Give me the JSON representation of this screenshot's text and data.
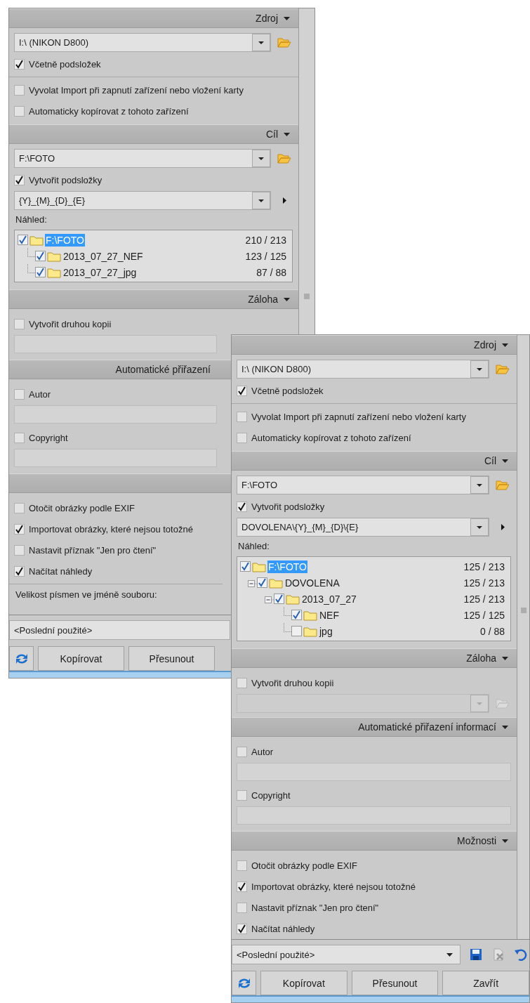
{
  "windows": [
    {
      "sections": [
        {
          "title": "Zdroj",
          "items": [
            {
              "kind": "path",
              "value": "I:\\ (NIKON D800)"
            },
            {
              "kind": "check",
              "label": "Včetně podsložek",
              "checked": true
            },
            {
              "kind": "rule"
            },
            {
              "kind": "check",
              "label": "Vyvolat Import při zapnutí zařízení nebo vložení karty",
              "checked": false
            },
            {
              "kind": "check",
              "label": "Automaticky kopírovat z tohoto zařízení",
              "checked": false
            }
          ]
        },
        {
          "title": "Cíl",
          "items": [
            {
              "kind": "path",
              "value": "F:\\FOTO"
            },
            {
              "kind": "check",
              "label": "Vytvořit podsložky",
              "checked": true
            },
            {
              "kind": "pattern",
              "value": "{Y}_{M}_{D}_{E}"
            },
            {
              "kind": "label",
              "text": "Náhled:"
            },
            {
              "kind": "tree",
              "nodes": [
                {
                  "label": "F:\\FOTO",
                  "count": "210 / 213",
                  "checked": true,
                  "selected": true,
                  "children": [
                    {
                      "label": "2013_07_27_NEF",
                      "count": "123 / 125",
                      "checked": true,
                      "selected": false
                    },
                    {
                      "label": "2013_07_27_jpg",
                      "count": "87 / 88",
                      "checked": true,
                      "selected": false
                    }
                  ]
                }
              ]
            }
          ]
        },
        {
          "title": "Záloha",
          "items": [
            {
              "kind": "check",
              "label": "Vytvořit druhou kopii",
              "checked": false
            },
            {
              "kind": "field"
            }
          ]
        },
        {
          "title": "Automatické přiřazení",
          "items": [
            {
              "kind": "check",
              "label": "Autor",
              "checked": false
            },
            {
              "kind": "field"
            },
            {
              "kind": "check",
              "label": "Copyright",
              "checked": false
            },
            {
              "kind": "field"
            }
          ]
        },
        {
          "items": [
            {
              "kind": "check",
              "label": "Otočit obrázky podle EXIF",
              "checked": false
            },
            {
              "kind": "check",
              "label": "Importovat obrázky, které nejsou totožné",
              "checked": true
            },
            {
              "kind": "check",
              "label": "Nastavit příznak \"Jen pro čtení\"",
              "checked": false
            },
            {
              "kind": "check",
              "label": "Načítat náhledy",
              "checked": true
            },
            {
              "kind": "rule"
            },
            {
              "kind": "label",
              "text": "Velikost písmen ve jméně souboru:"
            }
          ]
        }
      ],
      "footer": {
        "preset": "<Poslední použité>",
        "buttons": [
          "Kopírovat",
          "Přesunout"
        ]
      }
    },
    {
      "sections": [
        {
          "title": "Zdroj",
          "items": [
            {
              "kind": "path",
              "value": "I:\\ (NIKON D800)"
            },
            {
              "kind": "check",
              "label": "Včetně podsložek",
              "checked": true
            },
            {
              "kind": "rule"
            },
            {
              "kind": "check",
              "label": "Vyvolat Import při zapnutí zařízení nebo vložení karty",
              "checked": false
            },
            {
              "kind": "check",
              "label": "Automaticky kopírovat z tohoto zařízení",
              "checked": false
            }
          ]
        },
        {
          "title": "Cíl",
          "items": [
            {
              "kind": "path",
              "value": "F:\\FOTO"
            },
            {
              "kind": "check",
              "label": "Vytvořit podsložky",
              "checked": true
            },
            {
              "kind": "pattern",
              "value": "DOVOLENA\\{Y}_{M}_{D}\\{E}"
            },
            {
              "kind": "label",
              "text": "Náhled:"
            },
            {
              "kind": "tree",
              "nodes": [
                {
                  "label": "F:\\FOTO",
                  "count": "125 / 213",
                  "checked": true,
                  "selected": true,
                  "children": [
                    {
                      "label": "DOVOLENA",
                      "count": "125 / 213",
                      "checked": true,
                      "selected": false,
                      "children": [
                        {
                          "label": "2013_07_27",
                          "count": "125 / 213",
                          "checked": true,
                          "selected": false,
                          "children": [
                            {
                              "label": "NEF",
                              "count": "125 / 125",
                              "checked": true,
                              "selected": false
                            },
                            {
                              "label": "jpg",
                              "count": "0 / 88",
                              "checked": false,
                              "selected": false
                            }
                          ]
                        }
                      ]
                    }
                  ]
                }
              ]
            }
          ]
        },
        {
          "title": "Záloha",
          "items": [
            {
              "kind": "check",
              "label": "Vytvořit druhou kopii",
              "checked": false
            },
            {
              "kind": "path",
              "disabled": true
            }
          ]
        },
        {
          "title": "Automatické přiřazení informací",
          "items": [
            {
              "kind": "check",
              "label": "Autor",
              "checked": false
            },
            {
              "kind": "field"
            },
            {
              "kind": "check",
              "label": "Copyright",
              "checked": false
            },
            {
              "kind": "field"
            }
          ]
        },
        {
          "title": "Možnosti",
          "items": [
            {
              "kind": "check",
              "label": "Otočit obrázky podle EXIF",
              "checked": false
            },
            {
              "kind": "check",
              "label": "Importovat obrázky, které nejsou totožné",
              "checked": true
            },
            {
              "kind": "check",
              "label": "Nastavit příznak \"Jen pro čtení\"",
              "checked": false
            },
            {
              "kind": "check",
              "label": "Načítat náhledy",
              "checked": true
            }
          ]
        }
      ],
      "footer": {
        "preset": "<Poslední použité>",
        "buttons": [
          "Kopírovat",
          "Přesunout",
          "Zavřít"
        ]
      }
    }
  ]
}
